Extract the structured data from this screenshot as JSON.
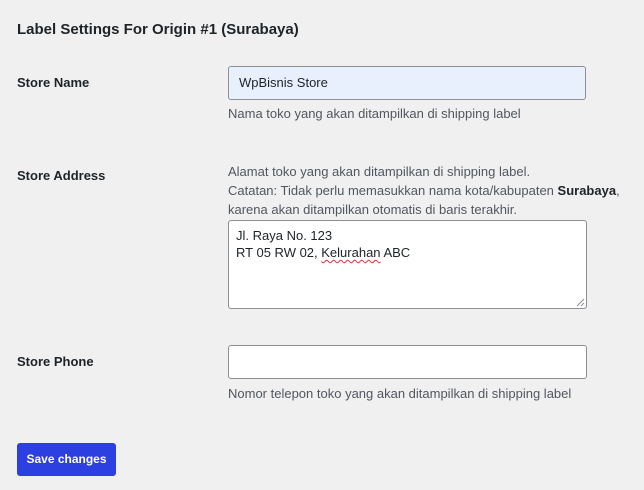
{
  "section_title": "Label Settings For Origin #1 (Surabaya)",
  "store_name": {
    "label": "Store Name",
    "value": "WpBisnis Store",
    "description": "Nama toko yang akan ditampilkan di shipping label"
  },
  "store_address": {
    "label": "Store Address",
    "description_line1": "Alamat toko yang akan ditampilkan di shipping label.",
    "description_line2_prefix": "Catatan: Tidak perlu memasukkan nama kota/kabupaten ",
    "description_city": "Surabaya",
    "description_line2_suffix": ",",
    "description_line3": "karena akan ditampilkan otomatis di baris terakhir.",
    "value_line1": "Jl. Raya No. 123",
    "value_line2_prefix": "RT 05 RW 02, ",
    "value_line2_misspelled": "Kelurahan",
    "value_line2_suffix": " ABC"
  },
  "store_phone": {
    "label": "Store Phone",
    "value": "",
    "description": "Nomor telepon toko yang akan ditampilkan di shipping label"
  },
  "save_button": "Save changes",
  "colors": {
    "background": "#f0f0f1",
    "button": "#2c3fe0",
    "autofill": "#e8f0fe"
  }
}
